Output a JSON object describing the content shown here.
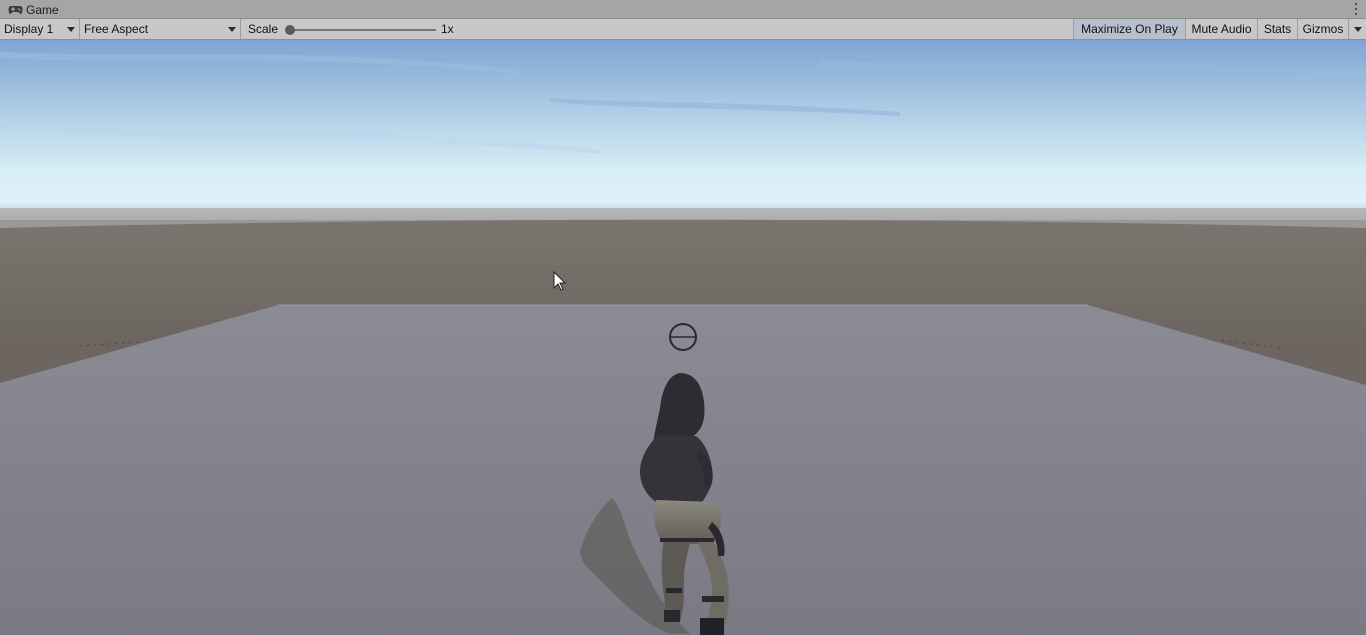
{
  "window": {
    "tab_title": "Game",
    "tab_icon": "gamepad-icon"
  },
  "toolbar": {
    "display_select": "Display 1",
    "aspect_select": "Free Aspect",
    "scale_label": "Scale",
    "scale_value": "1x",
    "maximize_on_play": "Maximize On Play",
    "mute_audio": "Mute Audio",
    "stats": "Stats",
    "gizmos": "Gizmos"
  },
  "colors": {
    "tab_bar": "#a5a5a5",
    "toolbar": "#c8c8c8",
    "toggle_active": "#b6bfcc",
    "sky_top": "#7ea4d3",
    "sky_horizon": "#dff1f8",
    "ground": "#6b655f",
    "floor": "#868590"
  }
}
